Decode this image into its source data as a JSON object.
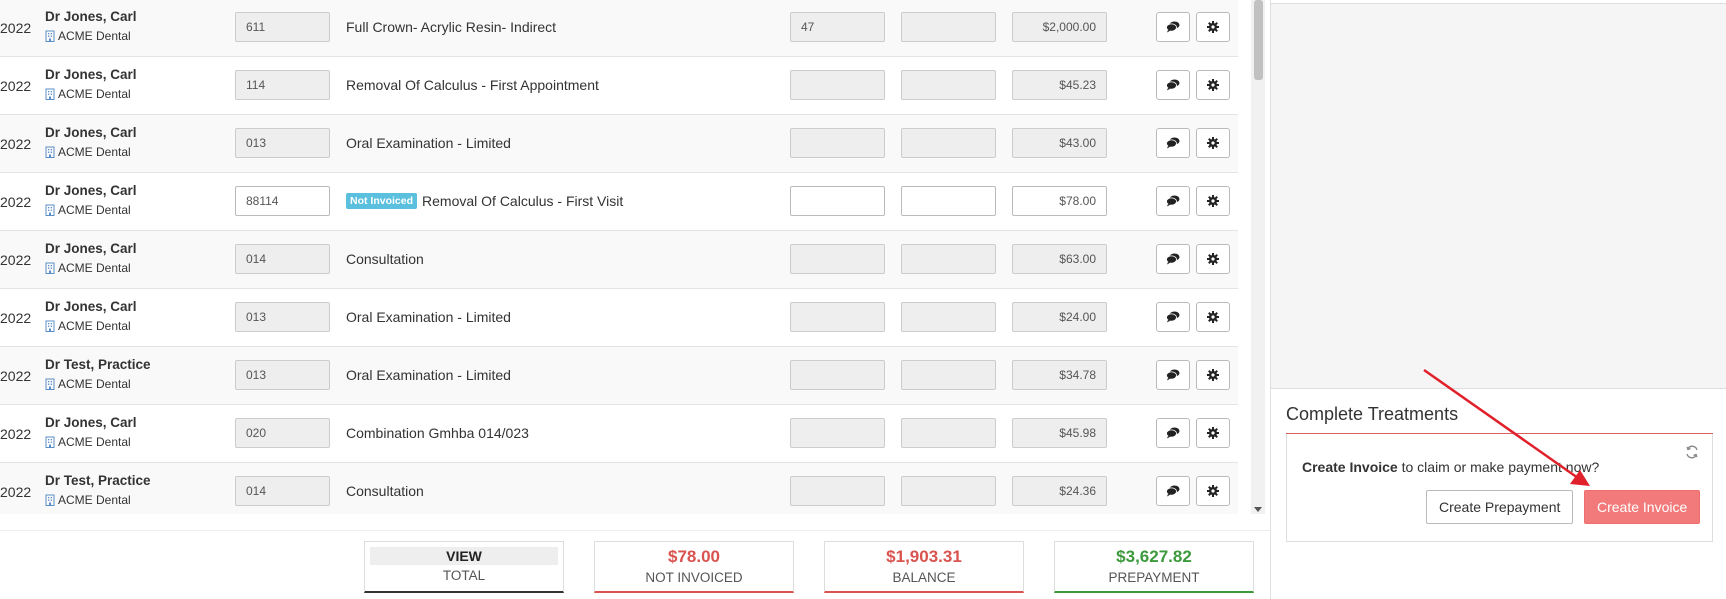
{
  "rows": [
    {
      "date": "2022",
      "provider": "Dr Jones, Carl",
      "clinic": "ACME Dental",
      "code": "611",
      "badge": "",
      "description": "Full Crown- Acrylic Resin- Indirect",
      "tooth": "47",
      "surface": "",
      "fee": "$2,000.00",
      "editable": false
    },
    {
      "date": "2022",
      "provider": "Dr Jones, Carl",
      "clinic": "ACME Dental",
      "code": "114",
      "badge": "",
      "description": "Removal Of Calculus - First Appointment",
      "tooth": "",
      "surface": "",
      "fee": "$45.23",
      "editable": false
    },
    {
      "date": "2022",
      "provider": "Dr Jones, Carl",
      "clinic": "ACME Dental",
      "code": "013",
      "badge": "",
      "description": "Oral Examination - Limited",
      "tooth": "",
      "surface": "",
      "fee": "$43.00",
      "editable": false
    },
    {
      "date": "2022",
      "provider": "Dr Jones, Carl",
      "clinic": "ACME Dental",
      "code": "88114",
      "badge": "Not Invoiced",
      "description": "Removal Of Calculus - First Visit",
      "tooth": "",
      "surface": "",
      "fee": "$78.00",
      "editable": true
    },
    {
      "date": "2022",
      "provider": "Dr Jones, Carl",
      "clinic": "ACME Dental",
      "code": "014",
      "badge": "",
      "description": "Consultation",
      "tooth": "",
      "surface": "",
      "fee": "$63.00",
      "editable": false
    },
    {
      "date": "2022",
      "provider": "Dr Jones, Carl",
      "clinic": "ACME Dental",
      "code": "013",
      "badge": "",
      "description": "Oral Examination - Limited",
      "tooth": "",
      "surface": "",
      "fee": "$24.00",
      "editable": false
    },
    {
      "date": "2022",
      "provider": "Dr Test, Practice",
      "clinic": "ACME Dental",
      "code": "013",
      "badge": "",
      "description": "Oral Examination - Limited",
      "tooth": "",
      "surface": "",
      "fee": "$34.78",
      "editable": false
    },
    {
      "date": "2022",
      "provider": "Dr Jones, Carl",
      "clinic": "ACME Dental",
      "code": "020",
      "badge": "",
      "description": "Combination Gmhba 014/023",
      "tooth": "",
      "surface": "",
      "fee": "$45.98",
      "editable": false
    },
    {
      "date": "2022",
      "provider": "Dr Test, Practice",
      "clinic": "ACME Dental",
      "code": "014",
      "badge": "",
      "description": "Consultation",
      "tooth": "",
      "surface": "",
      "fee": "$24.36",
      "editable": false
    }
  ],
  "totals": {
    "view": {
      "value": "VIEW",
      "label": "TOTAL"
    },
    "not_invoiced": {
      "value": "$78.00",
      "label": "NOT INVOICED"
    },
    "balance": {
      "value": "$1,903.31",
      "label": "BALANCE"
    },
    "prepayment": {
      "value": "$3,627.82",
      "label": "PREPAYMENT"
    }
  },
  "complete_treatments": {
    "title": "Complete Treatments",
    "prompt_bold": "Create Invoice",
    "prompt_rest": " to claim or make payment now?",
    "prepayment_button": "Create Prepayment",
    "invoice_button": "Create Invoice"
  },
  "colors": {
    "danger": "#d9534f",
    "success": "#3c9a3c",
    "badge": "#5bc0de",
    "invoice_button": "#f27a7a",
    "annotation_arrow": "#e0202a"
  },
  "icons": {
    "clinic": "building-icon",
    "comment": "comment-icon",
    "settings": "gear-icon",
    "refresh": "refresh-icon"
  }
}
